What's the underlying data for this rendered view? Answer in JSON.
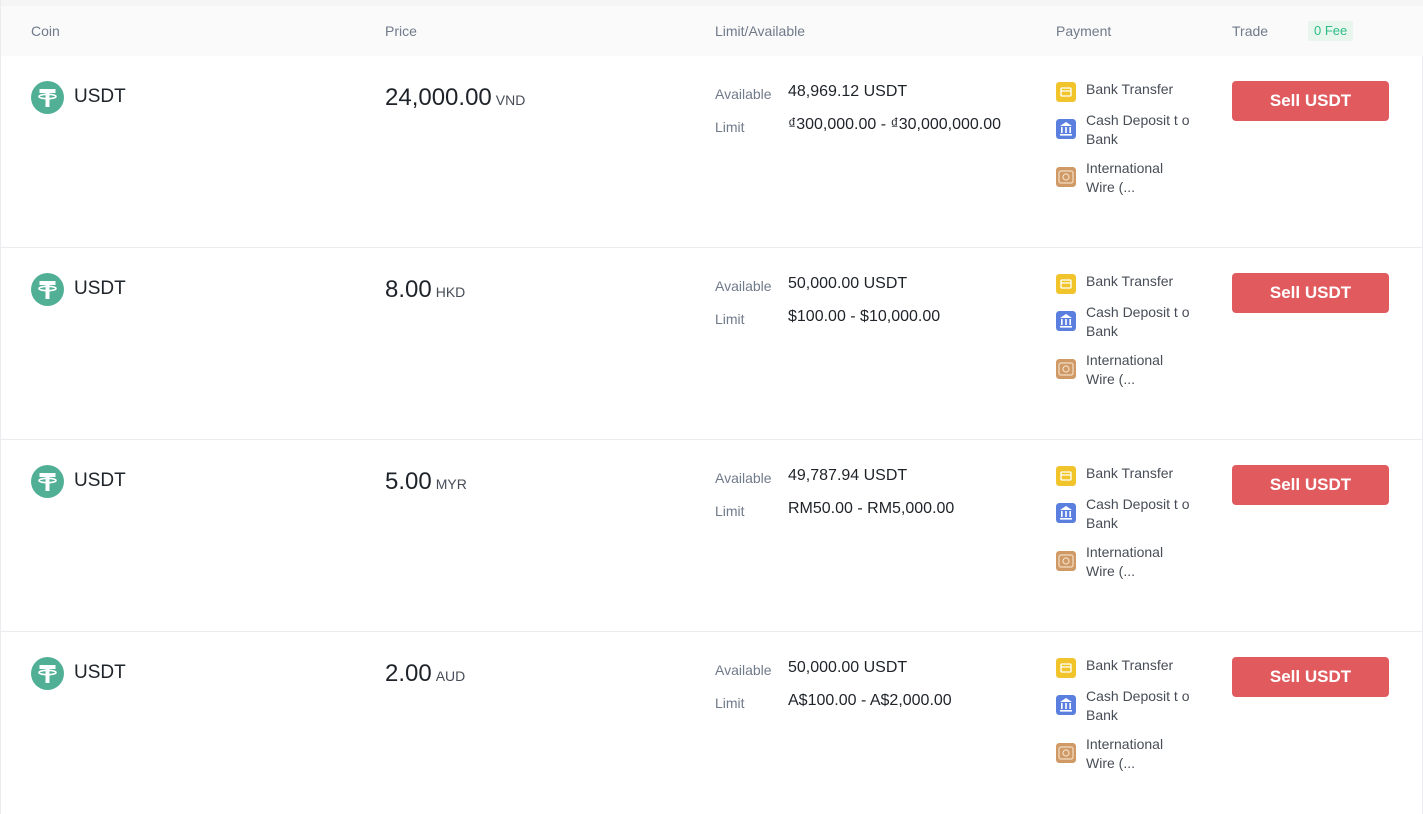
{
  "header": {
    "coin": "Coin",
    "price": "Price",
    "limit_available": "Limit/Available",
    "payment": "Payment",
    "trade": "Trade",
    "fee_badge": "0 Fee"
  },
  "labels": {
    "available": "Available",
    "limit": "Limit"
  },
  "colors": {
    "sell_button": "#e05a5e",
    "coin_icon": "#50af95",
    "fee_badge_text": "#2ebd85"
  },
  "rows": [
    {
      "coin": "USDT",
      "price": "24,000.00",
      "currency": "VND",
      "available": "48,969.12 USDT",
      "limit": "₫300,000.00 - ₫30,000,000.00",
      "payments": [
        "Bank Transfer",
        "Cash Deposit t o Bank",
        "International Wire (..."
      ],
      "button": "Sell USDT"
    },
    {
      "coin": "USDT",
      "price": "8.00",
      "currency": "HKD",
      "available": "50,000.00 USDT",
      "limit": "$100.00 - $10,000.00",
      "payments": [
        "Bank Transfer",
        "Cash Deposit t o Bank",
        "International Wire (..."
      ],
      "button": "Sell USDT"
    },
    {
      "coin": "USDT",
      "price": "5.00",
      "currency": "MYR",
      "available": "49,787.94 USDT",
      "limit": "RM50.00 - RM5,000.00",
      "payments": [
        "Bank Transfer",
        "Cash Deposit t o Bank",
        "International Wire (..."
      ],
      "button": "Sell USDT"
    },
    {
      "coin": "USDT",
      "price": "2.00",
      "currency": "AUD",
      "available": "50,000.00 USDT",
      "limit": "A$100.00 - A$2,000.00",
      "payments": [
        "Bank Transfer",
        "Cash Deposit t o Bank",
        "International Wire (..."
      ],
      "button": "Sell USDT"
    }
  ]
}
